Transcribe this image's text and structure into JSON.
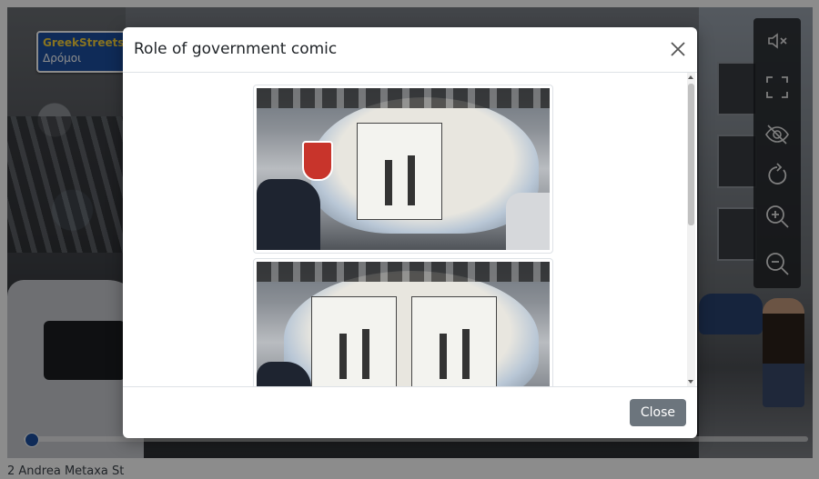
{
  "viewer": {
    "sign": {
      "line1": "GreekStreets",
      "line2": "Δρόμοι"
    },
    "progress_fraction": 0.0,
    "controls": [
      {
        "name": "mute-icon",
        "label": "mute"
      },
      {
        "name": "fullscreen-icon",
        "label": "fullscreen"
      },
      {
        "name": "hide-icon",
        "label": "hide"
      },
      {
        "name": "rotate-icon",
        "label": "rotate"
      },
      {
        "name": "zoom-in-icon",
        "label": "zoom in"
      },
      {
        "name": "zoom-out-icon",
        "label": "zoom out"
      }
    ]
  },
  "modal": {
    "title": "Role of government comic",
    "close_icon": "close-icon",
    "images": [
      {
        "name": "comic-photo-1"
      },
      {
        "name": "comic-photo-2"
      }
    ],
    "footer": {
      "close_label": "Close"
    }
  },
  "address": "2 Andrea Metaxa St",
  "colors": {
    "sign_blue": "#1c4fa0",
    "sign_yellow": "#f7d23c",
    "button_gray": "#6c757d",
    "progress_blue": "#2a62c9"
  }
}
